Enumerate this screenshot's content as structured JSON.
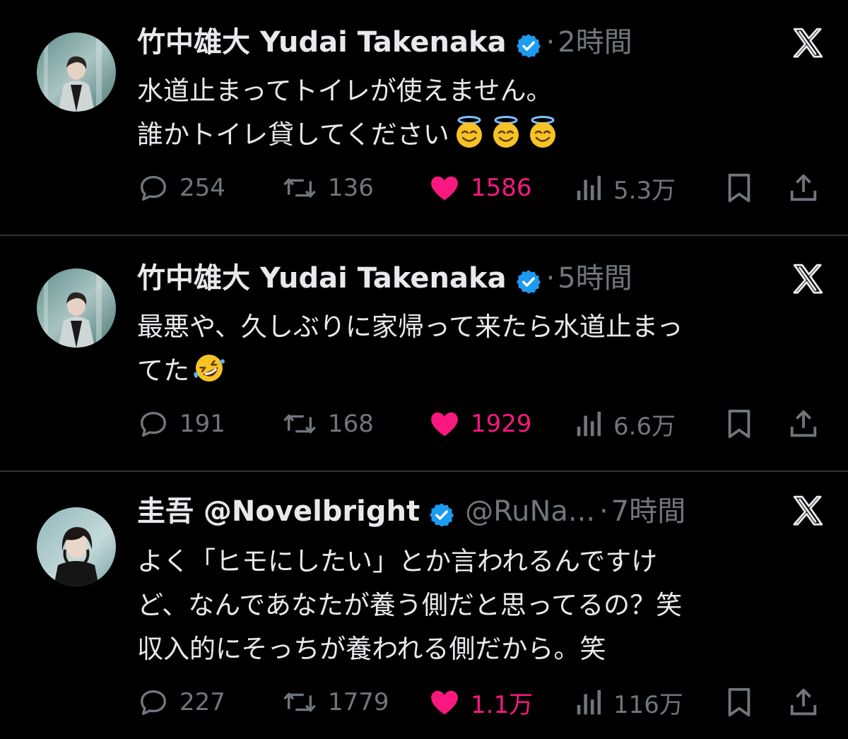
{
  "colors": {
    "background": "#000000",
    "text": "#e7e9ea",
    "muted": "#71767b",
    "like": "#f91880",
    "verified": "#1d9bf0",
    "divider": "#2f3336"
  },
  "tweets": [
    {
      "display_name": "竹中雄大 Yudai Takenaka",
      "handle": "",
      "dot": "·",
      "time": "2時間",
      "text_lines": [
        "水道止まってトイレが使えません。",
        "誰かトイレ貸してください"
      ],
      "emojis": [
        "smiling-face-with-halo",
        "smiling-face-with-halo",
        "smiling-face-with-halo"
      ],
      "replies": "254",
      "retweets": "136",
      "likes": "1586",
      "views": "5.3万",
      "liked": true
    },
    {
      "display_name": "竹中雄大 Yudai Takenaka",
      "handle": "",
      "dot": "·",
      "time": "5時間",
      "text_lines": [
        "最悪や、久しぶりに家帰って来たら水道止まっ",
        "てた"
      ],
      "emojis": [
        "rolling-on-the-floor-laughing"
      ],
      "replies": "191",
      "retweets": "168",
      "likes": "1929",
      "views": "6.6万",
      "liked": true
    },
    {
      "display_name": "圭吾 @Novelbright",
      "handle": "@RuNa...",
      "dot": "·",
      "time": "7時間",
      "text_lines": [
        "よく「ヒモにしたい」とか言われるんですけ",
        "ど、なんであなたが養う側だと思ってるの？笑",
        "収入的にそっちが養われる側だから。笑"
      ],
      "emojis": [],
      "replies": "227",
      "retweets": "1779",
      "likes": "1.1万",
      "views": "116万",
      "liked": true
    }
  ]
}
